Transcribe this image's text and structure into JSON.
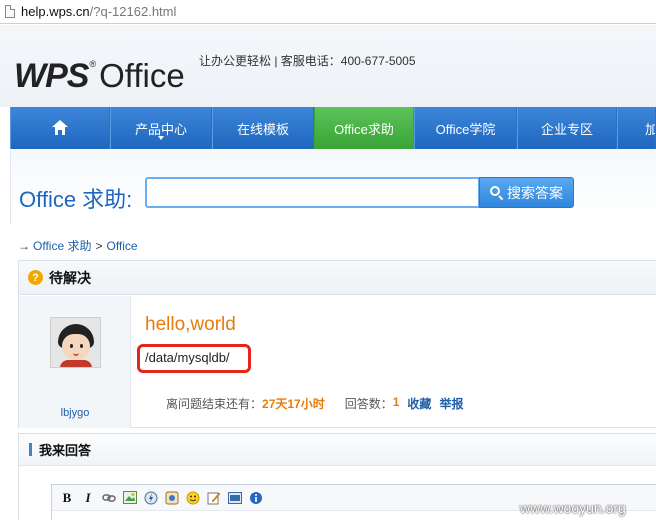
{
  "browser": {
    "host": "help.wps.cn",
    "path": "/?q-12162.html"
  },
  "header": {
    "logo_wps": "WPS",
    "logo_reg": "®",
    "logo_office": "Office",
    "slogan": "让办公更轻松 | 客服电话：400-677-5005"
  },
  "nav": {
    "items": [
      {
        "label": "产品中心"
      },
      {
        "label": "在线模板"
      },
      {
        "label": "Office求助"
      },
      {
        "label": "Office学院"
      },
      {
        "label": "企业专区"
      },
      {
        "label": "加入"
      }
    ],
    "active_index": 2
  },
  "search": {
    "label": "Office 求助:",
    "value": "",
    "button_label": "搜索答案"
  },
  "breadcrumb": {
    "arrow": "→",
    "items": [
      "Office 求助",
      "Office"
    ],
    "separator": ">"
  },
  "question": {
    "status_title": "待解决",
    "username": "lbjygo",
    "title": "hello,world",
    "body": "/data/mysqldb/",
    "remaining_label": "离问题结束还有：",
    "remaining_value": "27天17小时",
    "answers_label": "回答数：",
    "answers_value": "1",
    "favorite_label": "收藏",
    "report_label": "举报"
  },
  "answer": {
    "title": "我来回答",
    "toolbar": [
      "B",
      "I"
    ]
  },
  "watermark": "www.wooyun.org",
  "colors": {
    "nav_blue": "#1f66bf",
    "nav_active_green": "#3aa437",
    "title_orange": "#e97b0c",
    "highlight_red": "#e2261c"
  }
}
